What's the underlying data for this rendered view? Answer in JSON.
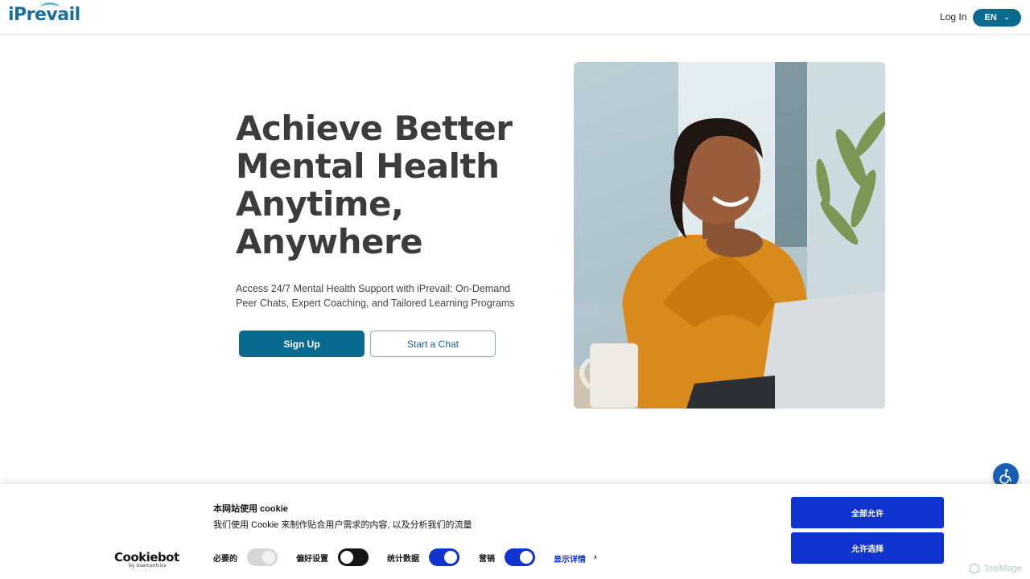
{
  "header": {
    "logo": "iPrevail",
    "login": "Log In",
    "language": "EN"
  },
  "hero": {
    "title_lines": [
      "Achieve Better",
      "Mental Health",
      "Anytime,",
      "Anywhere"
    ],
    "subtitle": "Access 24/7 Mental Health Support with iPrevail: On-Demand Peer Chats, Expert Coaching, and Tailored Learning Programs",
    "signup": "Sign Up",
    "chat": "Start a Chat"
  },
  "cookie": {
    "brand": "Cookiebot",
    "brand_sub": "by Usercentrics",
    "title": "本网站使用 cookie",
    "text": "我们使用 Cookie 来制作贴合用户需求的内容, 以及分析我们的流量",
    "toggles": [
      {
        "label": "必要的",
        "state": "disabled"
      },
      {
        "label": "偏好设置",
        "state": "off"
      },
      {
        "label": "统计数据",
        "state": "on"
      },
      {
        "label": "营销",
        "state": "on"
      }
    ],
    "details": "显示详情",
    "allow_all": "全部允许",
    "allow_selection": "允许选择"
  },
  "watermark": "ToolMage",
  "colors": {
    "brand": "#0a6b91",
    "cookie_blue": "#1032cf"
  }
}
